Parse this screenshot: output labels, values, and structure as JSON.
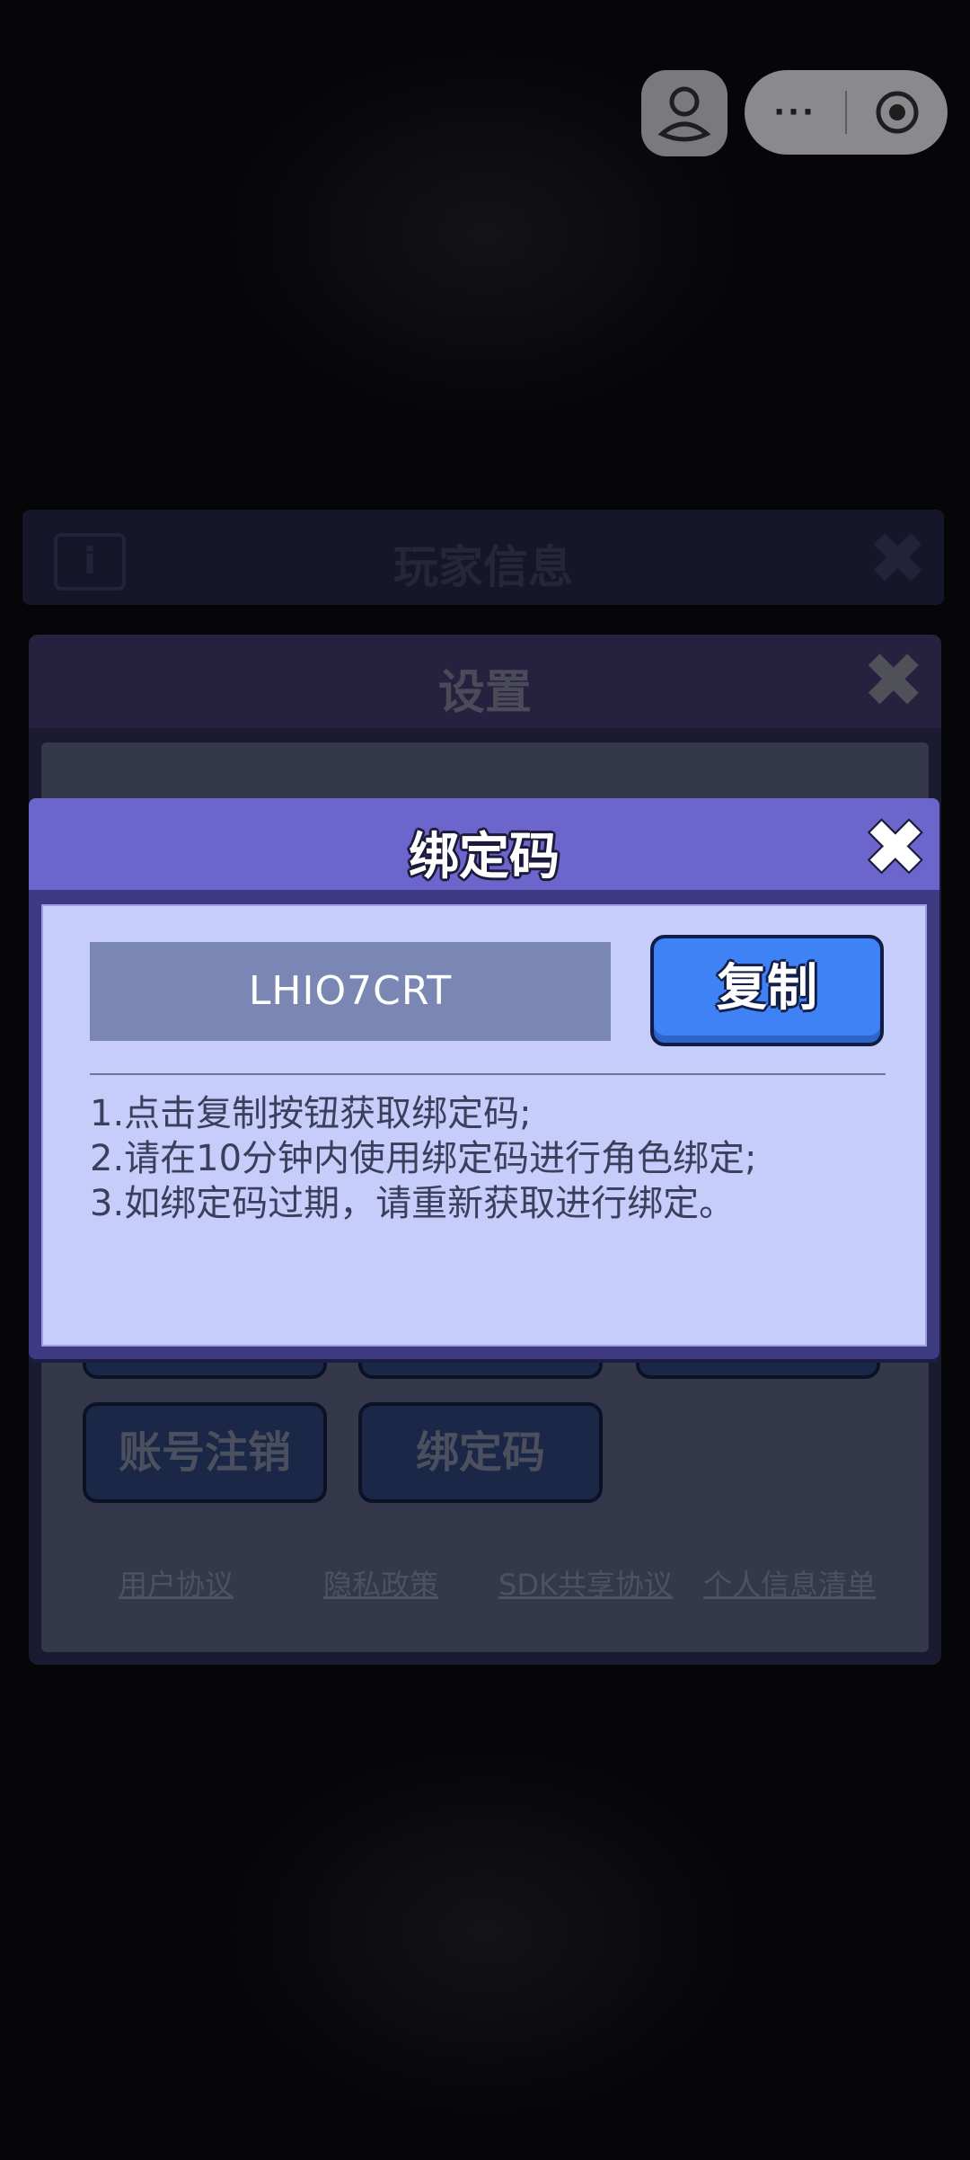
{
  "capsule": {
    "more_label": "···"
  },
  "player_panel": {
    "title": "玩家信息",
    "info_icon": "i"
  },
  "settings_panel": {
    "title": "设置",
    "buttons": {
      "account_cancel": "账号注销",
      "bind_code": "绑定码"
    },
    "links": [
      "用户协议",
      "隐私政策",
      "SDK共享协议",
      "个人信息清单"
    ]
  },
  "dialog": {
    "title": "绑定码",
    "code": "LHIO7CRT",
    "copy_label": "复制",
    "instructions": [
      "1.点击复制按钮获取绑定码;",
      "2.请在10分钟内使用绑定码进行角色绑定;",
      "3.如绑定码过期，请重新获取进行绑定。"
    ]
  },
  "colors": {
    "dialog_header": "#6c66cc",
    "dialog_body": "#c7cdfb",
    "copy_button": "#3f82f5",
    "code_box": "#7a87b4"
  },
  "icons": [
    "close-icon",
    "info-icon",
    "avatar-icon",
    "more-icon",
    "target-icon"
  ]
}
